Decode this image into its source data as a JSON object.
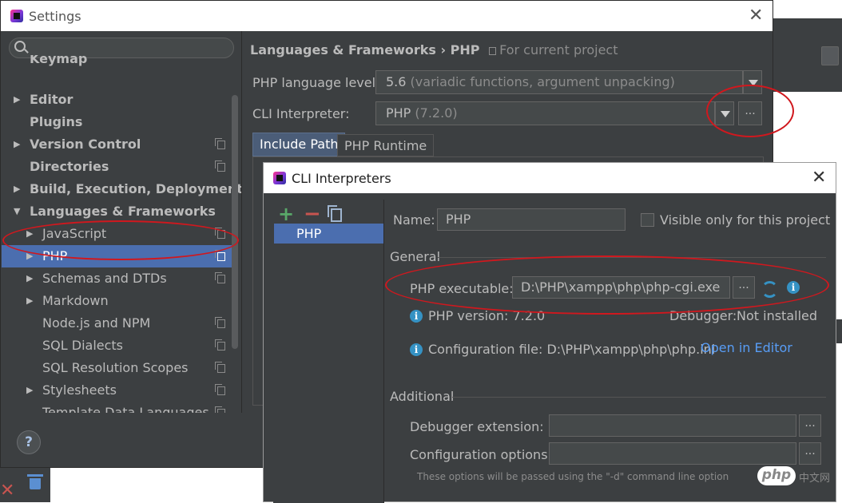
{
  "settings": {
    "title": "Settings",
    "search_placeholder": "",
    "tree": [
      {
        "label": "Keymap",
        "arrow": "",
        "bold": true,
        "copy": false
      },
      {
        "label": "Editor",
        "arrow": "▶",
        "bold": true,
        "copy": false
      },
      {
        "label": "Plugins",
        "arrow": "",
        "bold": true,
        "copy": false
      },
      {
        "label": "Version Control",
        "arrow": "▶",
        "bold": true,
        "copy": true
      },
      {
        "label": "Directories",
        "arrow": "",
        "bold": true,
        "copy": true
      },
      {
        "label": "Build, Execution, Deployment",
        "arrow": "▶",
        "bold": true,
        "copy": false
      },
      {
        "label": "Languages & Frameworks",
        "arrow": "▼",
        "bold": true,
        "copy": false
      },
      {
        "label": "JavaScript",
        "arrow": "▶",
        "bold": false,
        "copy": true
      },
      {
        "label": "PHP",
        "arrow": "▶",
        "bold": false,
        "copy": true,
        "selected": true
      },
      {
        "label": "Schemas and DTDs",
        "arrow": "▶",
        "bold": false,
        "copy": true
      },
      {
        "label": "Markdown",
        "arrow": "▶",
        "bold": false,
        "copy": false
      },
      {
        "label": "Node.js and NPM",
        "arrow": "",
        "bold": false,
        "copy": true
      },
      {
        "label": "SQL Dialects",
        "arrow": "",
        "bold": false,
        "copy": true
      },
      {
        "label": "SQL Resolution Scopes",
        "arrow": "",
        "bold": false,
        "copy": true
      },
      {
        "label": "Stylesheets",
        "arrow": "▶",
        "bold": false,
        "copy": true
      },
      {
        "label": "Template Data Languages",
        "arrow": "",
        "bold": false,
        "copy": true
      }
    ],
    "help_label": "?",
    "breadcrumb": {
      "section": "Languages & Frameworks",
      "separator": "›",
      "page": "PHP",
      "scope": "For current project"
    },
    "language_level_label": "PHP language level:",
    "language_level_value": "5.6",
    "language_level_detail": "(variadic functions, argument unpacking)",
    "cli_interpreter_label": "CLI Interpreter:",
    "cli_interpreter_value": "PHP",
    "cli_interpreter_version": "(7.2.0)",
    "more_button": "...",
    "tabs": [
      "Include Path",
      "PHP Runtime"
    ]
  },
  "cli_dialog": {
    "title": "CLI Interpreters",
    "list_items": [
      "PHP"
    ],
    "name_label": "Name:",
    "name_value": "PHP",
    "visible_only_label": "Visible only for this project",
    "general_label": "General",
    "executable_label": "PHP executable:",
    "executable_value": "D:\\PHP\\xampp\\php\\php-cgi.exe",
    "more_button": "...",
    "php_version_label": "PHP version: 7.2.0",
    "debugger_label": "Debugger:",
    "debugger_value": "Not installed",
    "config_file_label": "Configuration file: D:\\PHP\\xampp\\php\\php.ini",
    "open_in_editor": "Open in Editor",
    "additional_label": "Additional",
    "debugger_extension_label": "Debugger extension:",
    "configuration_options_label": "Configuration options:",
    "note": "These options will be passed using the \"-d\" command line option"
  },
  "watermark": {
    "logo": "php",
    "text": "中文网"
  },
  "colors": {
    "accent_selection": "#4b6eaf",
    "annotation_red": "#d0181e",
    "link": "#589df6"
  }
}
